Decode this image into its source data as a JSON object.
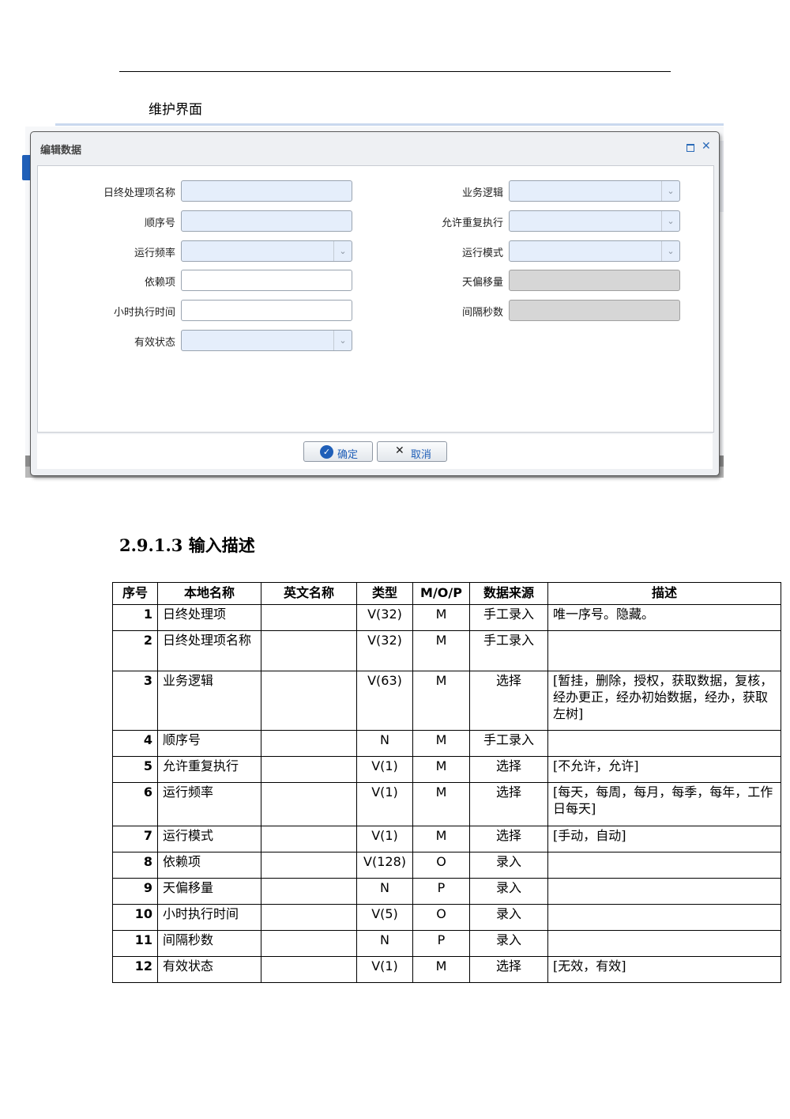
{
  "section_label": "维护界面",
  "dialog": {
    "title": "编辑数据",
    "fields_left": [
      {
        "label": "日终处理项名称",
        "kind": "text-tinted"
      },
      {
        "label": "顺序号",
        "kind": "text-tinted"
      },
      {
        "label": "运行频率",
        "kind": "select"
      },
      {
        "label": "依赖项",
        "kind": "text"
      },
      {
        "label": "小时执行时间",
        "kind": "text"
      },
      {
        "label": "有效状态",
        "kind": "select"
      }
    ],
    "fields_right": [
      {
        "label": "业务逻辑",
        "kind": "select"
      },
      {
        "label": "允许重复执行",
        "kind": "select"
      },
      {
        "label": "运行模式",
        "kind": "select"
      },
      {
        "label": "天偏移量",
        "kind": "disabled"
      },
      {
        "label": "间隔秒数",
        "kind": "disabled"
      }
    ],
    "ok_label": "确定",
    "cancel_label": "取消",
    "icons": {
      "maximize": "maximize-icon",
      "close": "close-icon",
      "ok": "check-circle-icon",
      "cancel": "x-icon"
    }
  },
  "heading": "2.9.1.3  输入描述",
  "table": {
    "headers": [
      "序号",
      "本地名称",
      "英文名称",
      "类型",
      "M/O/P",
      "数据来源",
      "描述"
    ],
    "rows": [
      {
        "no": "1",
        "name": "日终处理项",
        "en": "",
        "type": "V(32)",
        "mop": "M",
        "source": "手工录入",
        "desc": "唯一序号。隐藏。"
      },
      {
        "no": "2",
        "name": "日终处理项名称",
        "en": "",
        "type": "V(32)",
        "mop": "M",
        "source": "手工录入",
        "desc": ""
      },
      {
        "no": "3",
        "name": "业务逻辑",
        "en": "",
        "type": "V(63)",
        "mop": "M",
        "source": "选择",
        "desc": "[暂挂，删除，授权，获取数据，复核，经办更正，经办初始数据，经办，获取左树]"
      },
      {
        "no": "4",
        "name": "顺序号",
        "en": "",
        "type": "N",
        "mop": "M",
        "source": "手工录入",
        "desc": ""
      },
      {
        "no": "5",
        "name": "允许重复执行",
        "en": "",
        "type": "V(1)",
        "mop": "M",
        "source": "选择",
        "desc": "[不允许，允许]"
      },
      {
        "no": "6",
        "name": "运行频率",
        "en": "",
        "type": "V(1)",
        "mop": "M",
        "source": "选择",
        "desc": "[每天，每周，每月，每季，每年，工作日每天]"
      },
      {
        "no": "7",
        "name": "运行模式",
        "en": "",
        "type": "V(1)",
        "mop": "M",
        "source": "选择",
        "desc": "[手动，自动]"
      },
      {
        "no": "8",
        "name": "依赖项",
        "en": "",
        "type": "V(128)",
        "mop": "O",
        "source": "录入",
        "desc": ""
      },
      {
        "no": "9",
        "name": "天偏移量",
        "en": "",
        "type": "N",
        "mop": "P",
        "source": "录入",
        "desc": ""
      },
      {
        "no": "10",
        "name": "小时执行时间",
        "en": "",
        "type": "V(5)",
        "mop": "O",
        "source": "录入",
        "desc": ""
      },
      {
        "no": "11",
        "name": "间隔秒数",
        "en": "",
        "type": "N",
        "mop": "P",
        "source": "录入",
        "desc": ""
      },
      {
        "no": "12",
        "name": "有效状态",
        "en": "",
        "type": "V(1)",
        "mop": "M",
        "source": "选择",
        "desc": "[无效，有效]"
      }
    ]
  }
}
